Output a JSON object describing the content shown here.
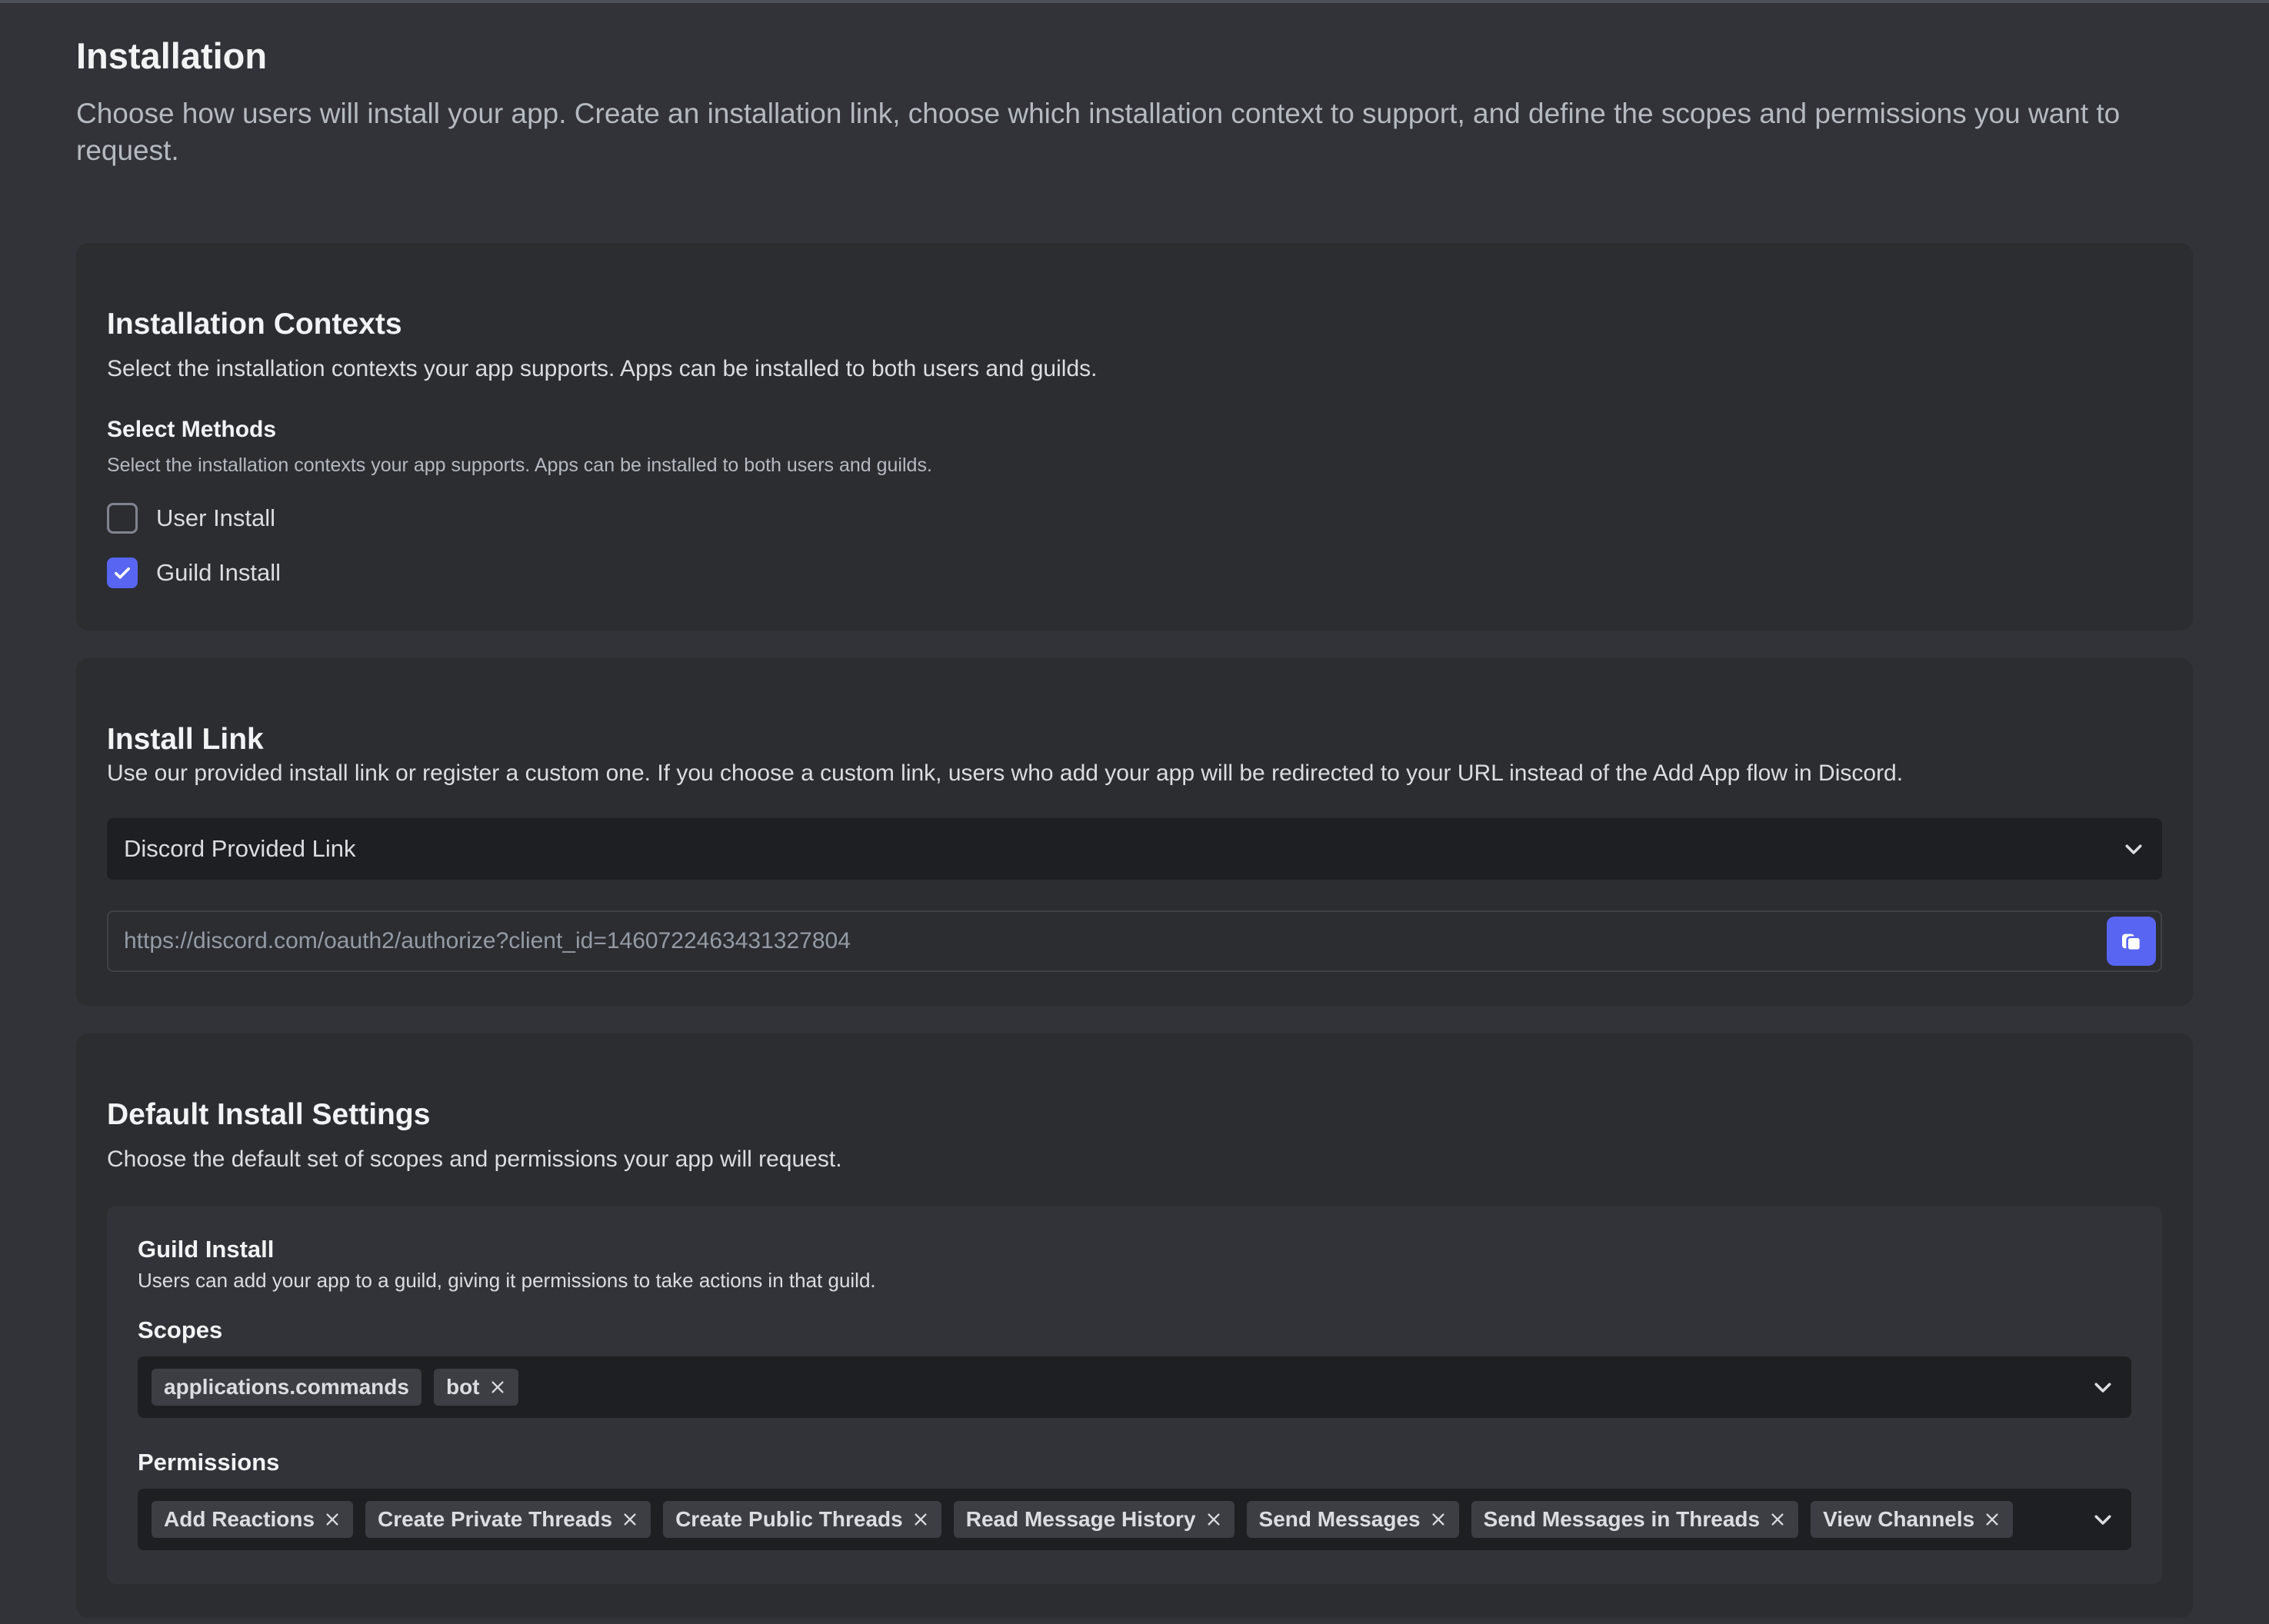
{
  "header": {
    "title": "Installation",
    "description": "Choose how users will install your app. Create an installation link, choose which installation context to support, and define the scopes and permissions you want to request."
  },
  "installation_contexts": {
    "title": "Installation Contexts",
    "description": "Select the installation contexts your app supports. Apps can be installed to both users and guilds.",
    "methods_title": "Select Methods",
    "methods_description": "Select the installation contexts your app supports. Apps can be installed to both users and guilds.",
    "options": [
      {
        "label": "User Install",
        "checked": false
      },
      {
        "label": "Guild Install",
        "checked": true
      }
    ]
  },
  "install_link": {
    "title": "Install Link",
    "description": "Use our provided install link or register a custom one. If you choose a custom link, users who add your app will be redirected to your URL instead of the Add App flow in Discord.",
    "selected_option": "Discord Provided Link",
    "url": "https://discord.com/oauth2/authorize?client_id=1460722463431327804"
  },
  "default_install": {
    "title": "Default Install Settings",
    "description": "Choose the default set of scopes and permissions your app will request.",
    "guild_install": {
      "title": "Guild Install",
      "description": "Users can add your app to a guild, giving it permissions to take actions in that guild.",
      "scopes_label": "Scopes",
      "scopes": [
        {
          "label": "applications.commands",
          "removable": false
        },
        {
          "label": "bot",
          "removable": true
        }
      ],
      "permissions_label": "Permissions",
      "permissions": [
        "Add Reactions",
        "Create Private Threads",
        "Create Public Threads",
        "Read Message History",
        "Send Messages",
        "Send Messages in Threads",
        "View Channels"
      ]
    }
  },
  "colors": {
    "background": "#313338",
    "card": "#2b2d31",
    "input": "#1e1f22",
    "accent": "#5865f2"
  },
  "icons": [
    "check-icon",
    "chevron-down-icon",
    "copy-icon",
    "close-icon"
  ]
}
